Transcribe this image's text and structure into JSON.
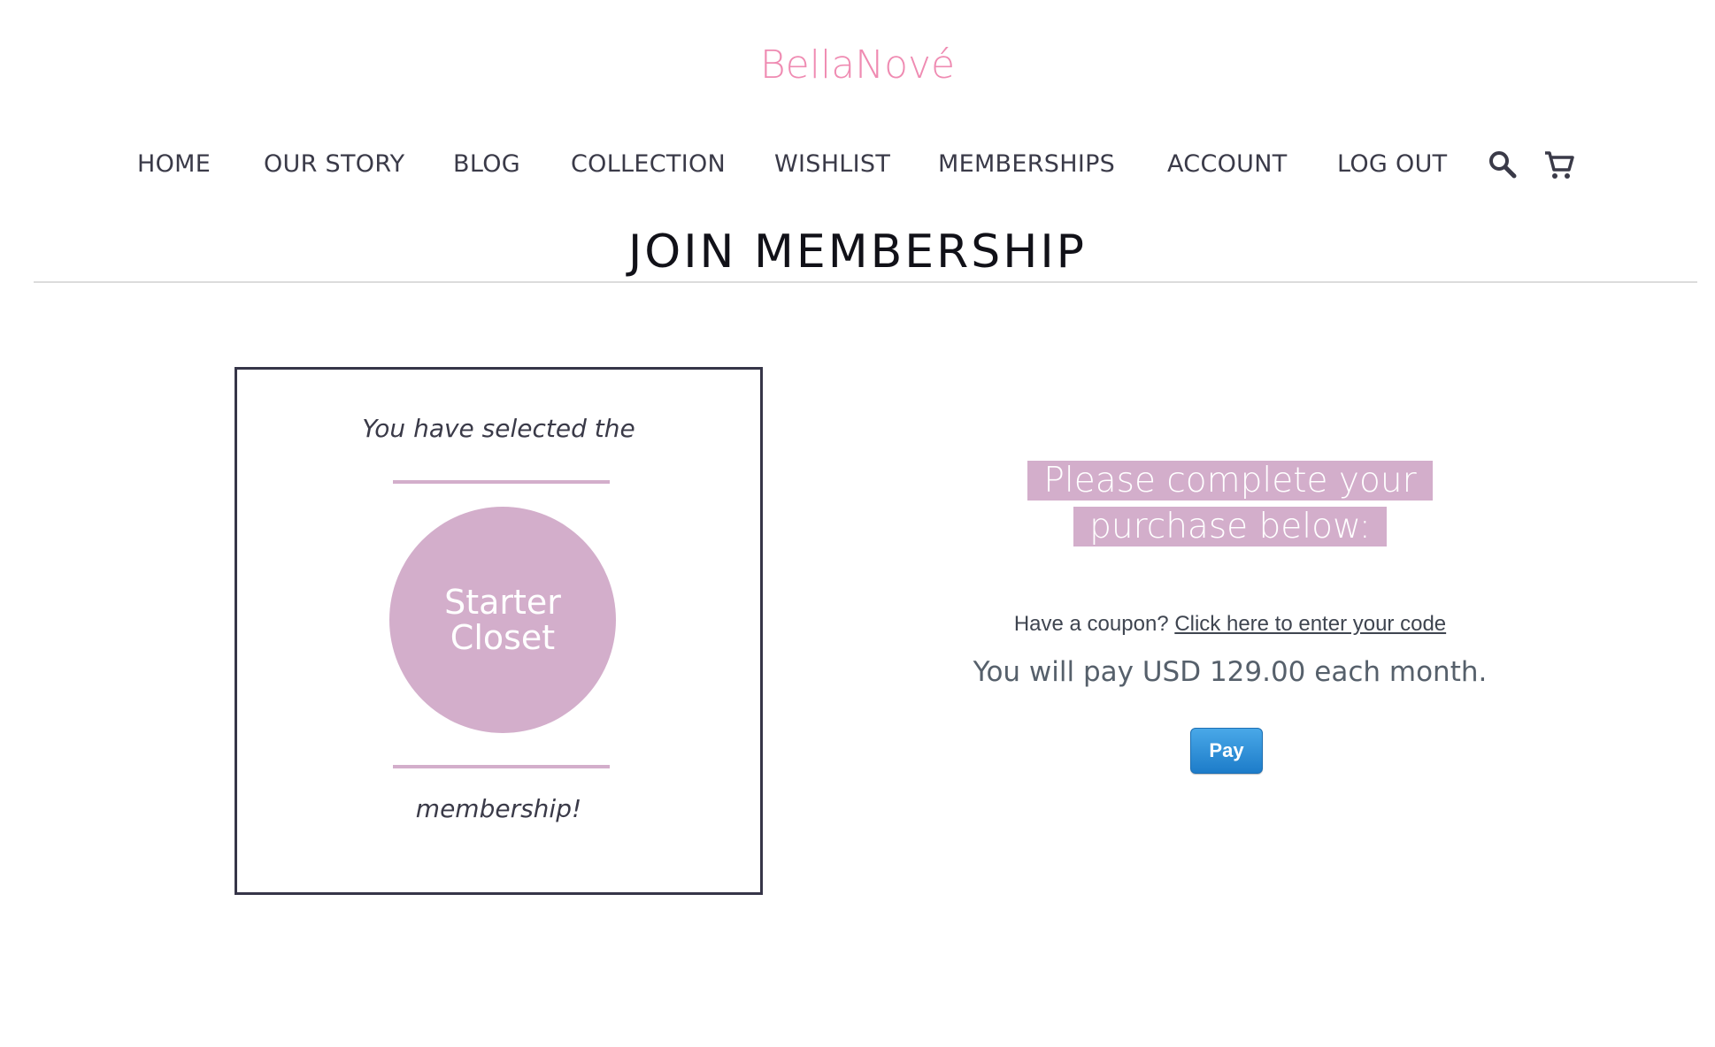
{
  "brand": {
    "logo_text": "BellaNové",
    "logo_color": "#ef8bb2"
  },
  "nav": {
    "items": [
      {
        "label": "HOME"
      },
      {
        "label": "OUR STORY"
      },
      {
        "label": "BLOG"
      },
      {
        "label": "COLLECTION"
      },
      {
        "label": "WISHLIST"
      },
      {
        "label": "MEMBERSHIPS"
      },
      {
        "label": "ACCOUNT"
      },
      {
        "label": "LOG OUT"
      }
    ],
    "icons": [
      "search-icon",
      "cart-icon"
    ]
  },
  "page": {
    "title": "JOIN MEMBERSHIP"
  },
  "membership_card": {
    "intro": "You have selected the",
    "plan_line1": "Starter",
    "plan_line2": "Closet",
    "outro": "membership!",
    "accent_color": "#d3aecb"
  },
  "checkout": {
    "prompt_line1": "Please complete your",
    "prompt_line2": "purchase below:",
    "coupon_prefix": "Have a coupon?",
    "coupon_link": "Click here to enter your code",
    "pay_summary": "You will pay USD 129.00 each month.",
    "pay_button": "Pay"
  }
}
